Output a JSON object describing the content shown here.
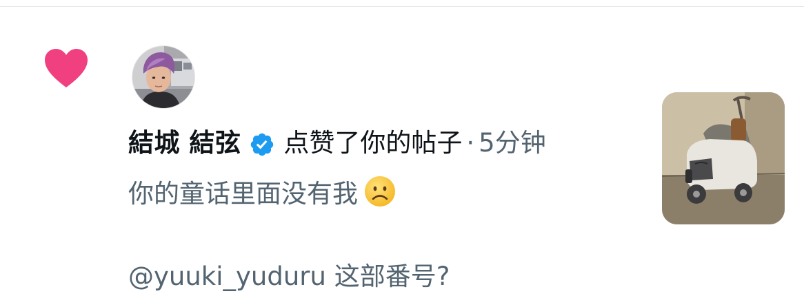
{
  "notification": {
    "user_name": "結城 結弦",
    "action": "点赞了你的帖子",
    "separator": "·",
    "time": "5分钟",
    "snippet": "你的童话里面没有我",
    "reply": "@yuuki_yuduru 这部番号?"
  },
  "icons": {
    "like": "heart-icon",
    "verified": "verified-badge-icon",
    "emoji": "frowning-face-emoji"
  },
  "colors": {
    "heart": "#F0407F",
    "verified": "#1D9BF0",
    "primary_text": "#0F1419",
    "secondary_text": "#536471"
  }
}
